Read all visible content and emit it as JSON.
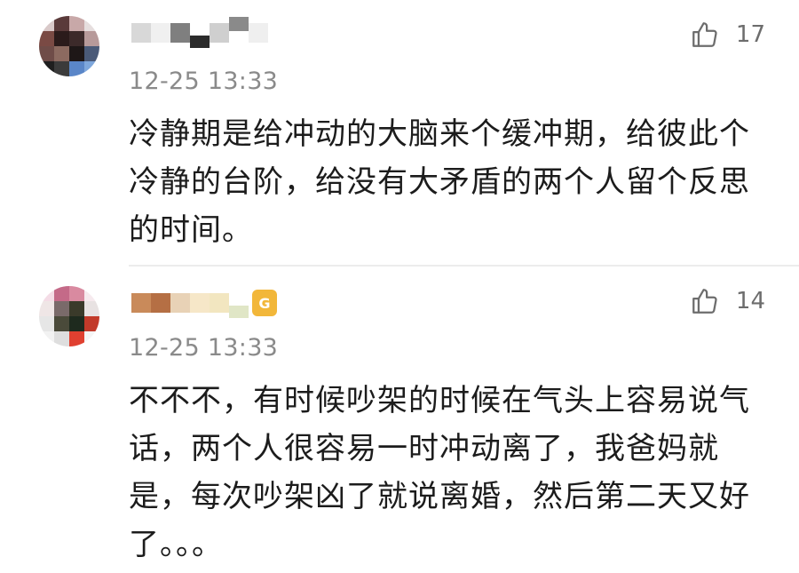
{
  "comments": [
    {
      "timestamp": "12-25 13:33",
      "likes": "17",
      "text": "冷静期是给冲动的大脑来个缓冲期，给彼此个冷静的台阶，给没有大矛盾的两个人留个反思的时间。",
      "colors": {
        "text": "#1c1c1c",
        "meta": "#8a8a8a"
      }
    },
    {
      "timestamp": "12-25 13:33",
      "likes": "14",
      "text": "不不不，有时候吵架的时候在气头上容易说气话，两个人很容易一时冲动离了，我爸妈就是，每次吵架凶了就说离婚，然后第二天又好了。。。",
      "colors": {
        "text": "#1c1c1c",
        "meta": "#8a8a8a"
      }
    }
  ],
  "icons": {
    "like": "thumbs-up-icon",
    "vip": "vip-badge-icon"
  }
}
